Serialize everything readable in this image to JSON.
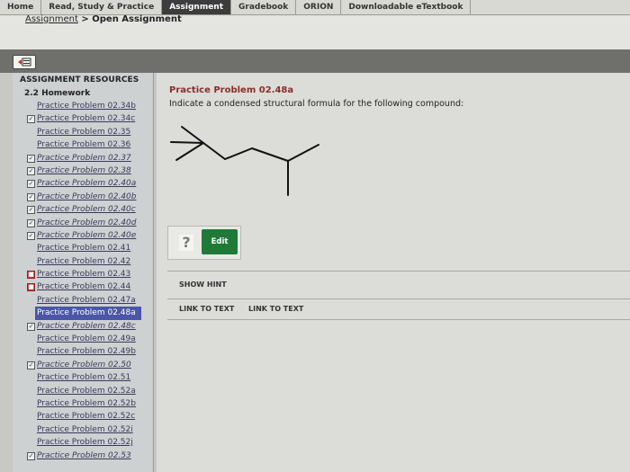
{
  "nav": {
    "tabs": [
      {
        "label": "Home"
      },
      {
        "label": "Read, Study & Practice"
      },
      {
        "label": "Assignment"
      },
      {
        "label": "Gradebook"
      },
      {
        "label": "ORION"
      },
      {
        "label": "Downloadable eTextbook"
      }
    ],
    "active_tab": "Assignment"
  },
  "breadcrumb": {
    "link": "Assignment",
    "separator": ">",
    "current": "Open Assignment"
  },
  "sidebar": {
    "resources_title": "ASSIGNMENT RESOURCES",
    "section_title": "2.2 Homework",
    "items": [
      {
        "label": "Practice Problem 02.34b",
        "status": "none",
        "italic": false
      },
      {
        "label": "Practice Problem 02.34c",
        "status": "check",
        "italic": false
      },
      {
        "label": "Practice Problem 02.35",
        "status": "none",
        "italic": false
      },
      {
        "label": "Practice Problem 02.36",
        "status": "none",
        "italic": false
      },
      {
        "label": "Practice Problem 02.37",
        "status": "check",
        "italic": true
      },
      {
        "label": "Practice Problem 02.38",
        "status": "check",
        "italic": true
      },
      {
        "label": "Practice Problem 02.40a",
        "status": "check",
        "italic": true
      },
      {
        "label": "Practice Problem 02.40b",
        "status": "check",
        "italic": true
      },
      {
        "label": "Practice Problem 02.40c",
        "status": "check",
        "italic": true
      },
      {
        "label": "Practice Problem 02.40d",
        "status": "check",
        "italic": true
      },
      {
        "label": "Practice Problem 02.40e",
        "status": "check",
        "italic": true
      },
      {
        "label": "Practice Problem 02.41",
        "status": "none",
        "italic": false
      },
      {
        "label": "Practice Problem 02.42",
        "status": "none",
        "italic": false
      },
      {
        "label": "Practice Problem 02.43",
        "status": "wrong",
        "italic": false
      },
      {
        "label": "Practice Problem 02.44",
        "status": "wrong",
        "italic": false
      },
      {
        "label": "Practice Problem 02.47a",
        "status": "none",
        "italic": false
      },
      {
        "label": "Practice Problem 02.48a",
        "status": "active",
        "italic": false
      },
      {
        "label": "Practice Problem 02.48c",
        "status": "check",
        "italic": true
      },
      {
        "label": "Practice Problem 02.49a",
        "status": "none",
        "italic": false
      },
      {
        "label": "Practice Problem 02.49b",
        "status": "none",
        "italic": false
      },
      {
        "label": "Practice Problem 02.50",
        "status": "check",
        "italic": true
      },
      {
        "label": "Practice Problem 02.51",
        "status": "none",
        "italic": false
      },
      {
        "label": "Practice Problem 02.52a",
        "status": "none",
        "italic": false
      },
      {
        "label": "Practice Problem 02.52b",
        "status": "none",
        "italic": false
      },
      {
        "label": "Practice Problem 02.52c",
        "status": "none",
        "italic": false
      },
      {
        "label": "Practice Problem 02.52i",
        "status": "none",
        "italic": false
      },
      {
        "label": "Practice Problem 02.52j",
        "status": "none",
        "italic": false
      },
      {
        "label": "Practice Problem 02.53",
        "status": "check",
        "italic": true
      }
    ]
  },
  "main": {
    "question_title": "Practice Problem 02.48a",
    "question_text": "Indicate a condensed structural formula for the following compound:",
    "answer_placeholder_icon": "?",
    "edit_label": "Edit",
    "show_hint_label": "SHOW HINT",
    "link_to_text_1": "LINK TO TEXT",
    "link_to_text_2": "LINK TO TEXT"
  },
  "colors": {
    "accent_title": "#8a2d2a",
    "edit_button": "#1f7a37",
    "active_item": "#4a56a8"
  }
}
